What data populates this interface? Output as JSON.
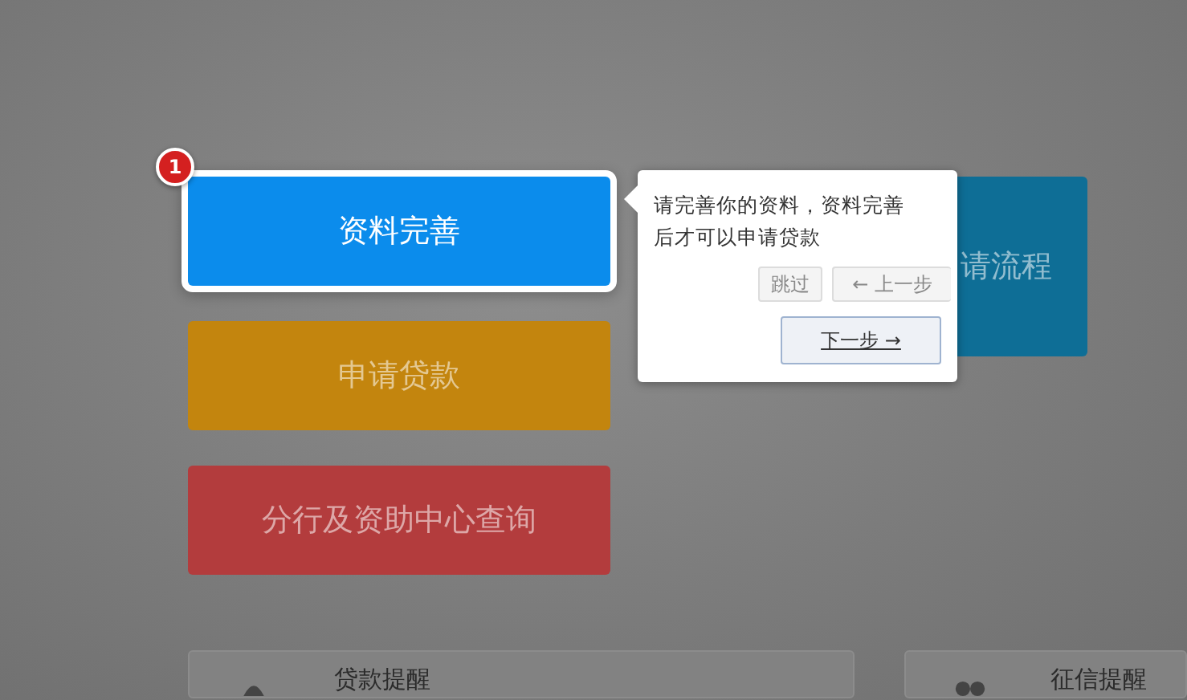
{
  "tiles": [
    {
      "label": "资料完善",
      "color": "#0b8cec",
      "highlighted": true
    },
    {
      "label": "申请贷款",
      "color": "#c3850e",
      "highlighted": false
    },
    {
      "label": "分行及资助中心查询",
      "color": "#b33c3d",
      "highlighted": false
    },
    {
      "label": "请流程",
      "color": "#0e6e96",
      "highlighted": false
    }
  ],
  "step_badge": "1",
  "tooltip": {
    "text": "请完善你的资料，资料完善后才可以申请贷款",
    "buttons": [
      {
        "label": "跳过",
        "kind": "skip"
      },
      {
        "label": "← 上一步",
        "kind": "prev"
      },
      {
        "label": "下一步 →",
        "kind": "next"
      }
    ]
  },
  "cards": [
    {
      "title": "贷款提醒"
    },
    {
      "title": "征信提醒"
    }
  ]
}
